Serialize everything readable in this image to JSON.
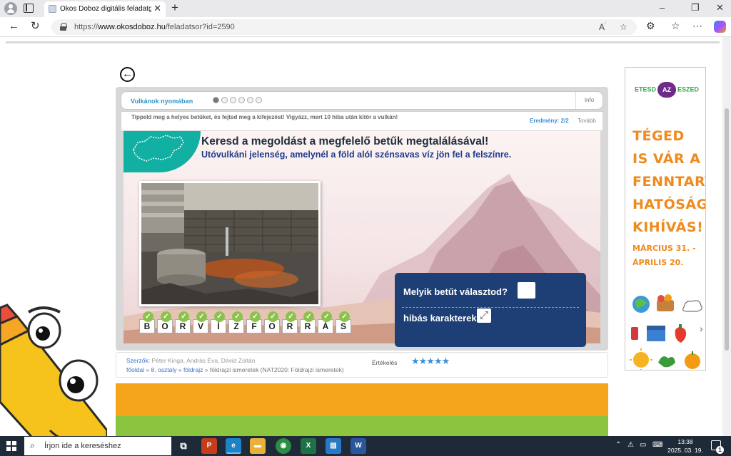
{
  "browser": {
    "tab_title": "Okos Doboz digitális feladatgyűjt",
    "tab_close": "✕",
    "new_tab": "+",
    "url_prefix": "https://",
    "url_host": "www.okosdoboz.hu",
    "url_path": "/feladatsor?id=2590",
    "minimize": "–",
    "maximize": "❐",
    "close": "✕"
  },
  "game": {
    "title": "Vulkánok nyomában",
    "progress_total": 6,
    "progress_current": 1,
    "info_label": "Info",
    "instructions": "Tippeld meg a helyes betűket, és fejtsd meg a kifejezést! Vigyázz, mert 10 hiba után kitör a vulkán!",
    "result_label": "Eredmény: 2/2",
    "next_label": "Tovább",
    "heading": "Keresd a megoldást a megfelelő betűk megtalálásával!",
    "subheading": "Utóvulkáni jelenség, amelynél a föld alól szénsavas víz jön fel a felszínre.",
    "letters": [
      "B",
      "O",
      "R",
      "V",
      "Í",
      "Z",
      "F",
      "O",
      "R",
      "R",
      "Á",
      "S"
    ],
    "question_label": "Melyik betűt választod?",
    "wrong_label": "hibás karakterek:"
  },
  "meta": {
    "author_label": "Szerzők:",
    "authors": "Péter Kinga, András Éva, Dávid Zoltán",
    "crumb_home": "főoldal",
    "crumb_sep": "»",
    "crumb_grade": "8. osztály",
    "crumb_subject": "földrajz",
    "crumb_topic": "földrajzi ismeretek (NAT2020: Földrajzi ismeretek)",
    "rating_label": "Értékelés",
    "rating_stars": 5
  },
  "ad": {
    "logo_left": "ETESD",
    "logo_mid": "AZ",
    "logo_right": "ESZED",
    "headline": "TÉGED IS VÁR A FENNTART-HATÓSÁGI KIHÍVÁS!",
    "dates": "MÁRCIUS 31. - ÁPRILIS 20.",
    "arrow": "›"
  },
  "taskbar": {
    "search_placeholder": "Írjon ide a kereséshez",
    "time": "13:38",
    "date": "2025. 03. 19.",
    "notifications": "1",
    "apps": [
      {
        "name": "task-view",
        "glyph": "⧉",
        "color": "#1f2a38"
      },
      {
        "name": "powerpoint",
        "glyph": "P",
        "color": "#c43e1c"
      },
      {
        "name": "edge",
        "glyph": "e",
        "color": "#1b84c6"
      },
      {
        "name": "file-explorer",
        "glyph": "▬",
        "color": "#e8b23a"
      },
      {
        "name": "chrome",
        "glyph": "◉",
        "color": "#2a8d43"
      },
      {
        "name": "excel",
        "glyph": "X",
        "color": "#1e7145"
      },
      {
        "name": "store",
        "glyph": "▤",
        "color": "#2679c6"
      },
      {
        "name": "word",
        "glyph": "W",
        "color": "#2b579a"
      }
    ]
  },
  "colors": {
    "accent_blue": "#3794c8",
    "panel_navy": "#1e3f75",
    "teal": "#12b0a2",
    "orange_band": "#f5a51a",
    "green_band": "#8bc53f",
    "ad_orange": "#ef8a1d"
  }
}
